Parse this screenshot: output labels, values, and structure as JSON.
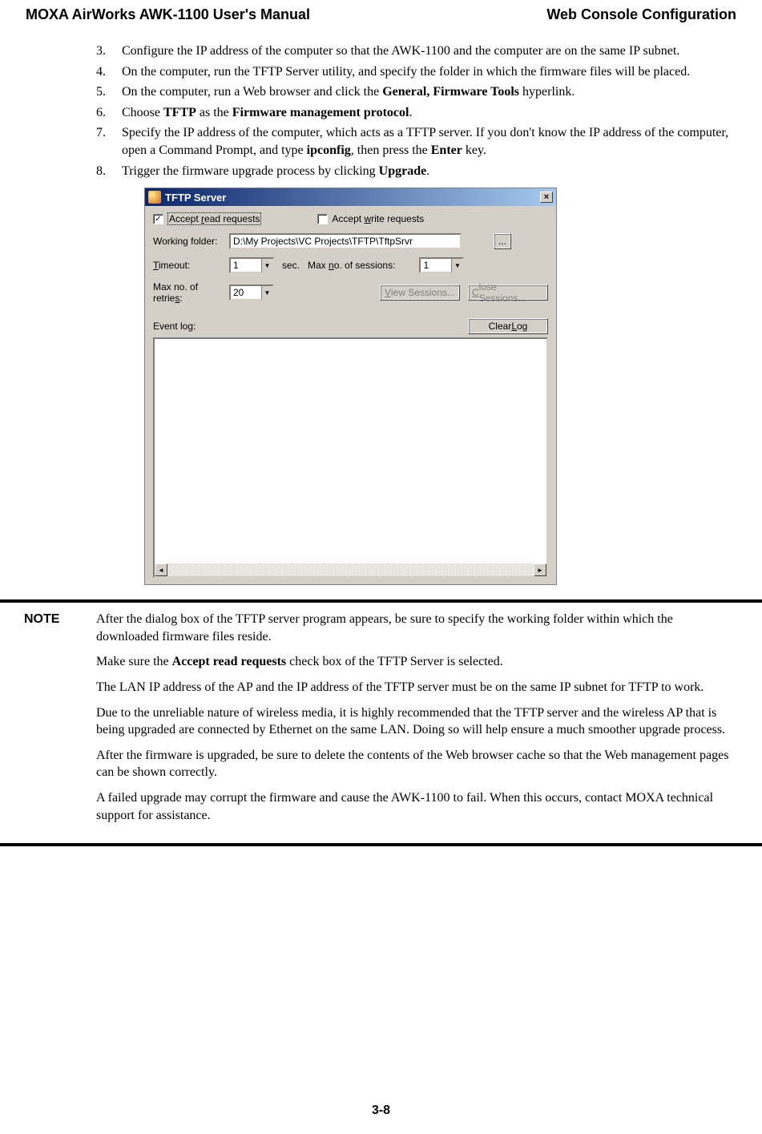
{
  "header": {
    "left": "MOXA AirWorks AWK-1100 User's Manual",
    "right": "Web Console Configuration"
  },
  "list": {
    "item3_num": "3.",
    "item3_text": "Configure the IP address of the computer so that the AWK-1100 and the computer are on the same IP subnet.",
    "item4_num": "4.",
    "item4_text": "On the computer, run the TFTP Server utility, and specify the folder in which the firmware files will be placed.",
    "item5_num": "5.",
    "item5_pre": "On the computer, run a Web browser and click the ",
    "item5_bold": "General, Firmware Tools",
    "item5_post": " hyperlink.",
    "item6_num": "6.",
    "item6_pre": "Choose ",
    "item6_bold1": "TFTP",
    "item6_mid": " as the ",
    "item6_bold2": "Firmware management protocol",
    "item6_post": ".",
    "item7_num": "7.",
    "item7_pre": "Specify the IP address of the computer, which acts as a TFTP server. If you don't know the IP address of the computer, open a Command Prompt, and type ",
    "item7_bold1": "ipconfig",
    "item7_mid": ", then press the ",
    "item7_bold2": "Enter",
    "item7_post": " key.",
    "item8_num": "8.",
    "item8_pre": "Trigger the firmware upgrade process by clicking ",
    "item8_bold": "Upgrade",
    "item8_post": "."
  },
  "tftp": {
    "title": "TFTP Server",
    "close": "×",
    "accept_read_pre": "Accept ",
    "accept_read_u": "r",
    "accept_read_post": "ead requests",
    "accept_write_pre": "Accept ",
    "accept_write_u": "w",
    "accept_write_post": "rite requests",
    "working_folder_label": "Working folder:",
    "working_folder_value": "D:\\My Projects\\VC Projects\\TFTP\\TftpSrvr",
    "browse": "...",
    "timeout_u": "T",
    "timeout_post": "imeout:",
    "timeout_value": "1",
    "sec": "sec.",
    "max_sessions_pre": "Max ",
    "max_sessions_u": "n",
    "max_sessions_post": "o. of sessions:",
    "max_sessions_value": "1",
    "max_retries_pre": "Max no. of retrie",
    "max_retries_u": "s",
    "max_retries_post": ":",
    "max_retries_value": "20",
    "view_sessions_u": "V",
    "view_sessions_post": "iew Sessions...",
    "close_sessions_u": "C",
    "close_sessions_post": "lose Sessions...",
    "event_log": "Event log:",
    "clear_log_pre": "Clear ",
    "clear_log_u": "L",
    "clear_log_post": "og",
    "checkmark": "✓",
    "arrow_down": "▼",
    "arrow_left": "◄",
    "arrow_right": "►"
  },
  "note": {
    "label": "NOTE",
    "p1": "After the dialog box of the TFTP server program appears, be sure to specify the working folder within which the downloaded firmware files reside.",
    "p2_pre": "Make sure the ",
    "p2_bold": "Accept read requests",
    "p2_post": " check box of the TFTP Server is selected.",
    "p3": "The LAN IP address of the AP and the IP address of the TFTP server must be on the same IP subnet for TFTP to work.",
    "p4": "Due to the unreliable nature of wireless media, it is highly recommended that the TFTP server and the wireless AP that is being upgraded are connected by Ethernet on the same LAN. Doing so will help ensure a much smoother upgrade process.",
    "p5": "After the firmware is upgraded, be sure to delete the contents of the Web browser cache so that the Web management pages can be shown correctly.",
    "p6": "A failed upgrade may corrupt the firmware and cause the AWK-1100 to fail. When this occurs, contact MOXA technical support for assistance."
  },
  "page_num": "3-8"
}
